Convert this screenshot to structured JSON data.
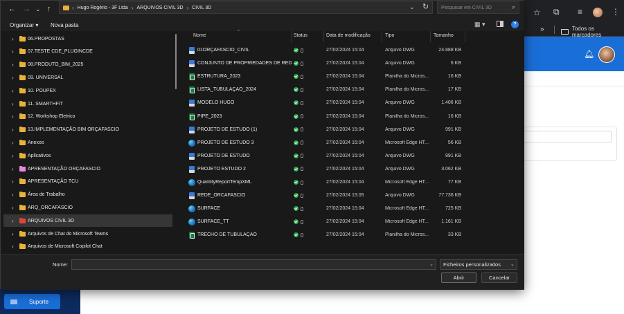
{
  "browser": {
    "bookmarks_folder_label": "Todos os marcadores",
    "overflow_chevron": "»",
    "support_button_label": "Suporte"
  },
  "dialog": {
    "nav_buttons": {
      "back": "←",
      "forward": "→",
      "recent": "⌄",
      "up": "↑"
    },
    "path_segments": [
      "Hugo Rogério - 3F Ltda",
      "ARQUIVOS CIVIL 3D",
      "CIVIL 3D"
    ],
    "search_placeholder": "Pesquisar em CIVIL 3D",
    "toolbar": {
      "organize_label": "Organizar ▾",
      "new_folder_label": "Nova pasta"
    },
    "nav_items": [
      {
        "label": "06.PROPOSTAS",
        "color": "#e8b33a"
      },
      {
        "label": "07.TESTE CDE_PLUGINCDE",
        "color": "#e8b33a"
      },
      {
        "label": "08.PRODUTO_BIM_2025",
        "color": "#e8b33a"
      },
      {
        "label": "09. UNIVERSAL",
        "color": "#e8b33a"
      },
      {
        "label": "10. POUPEX",
        "color": "#e8b33a"
      },
      {
        "label": "11. SMARTHFIT",
        "color": "#e8b33a"
      },
      {
        "label": "12. Workshop Eletrico",
        "color": "#e8b33a"
      },
      {
        "label": "13.IMPLEMENTAÇÃO BIM ORÇAFASCIO",
        "color": "#e8b33a"
      },
      {
        "label": "Anexos",
        "color": "#e8b33a"
      },
      {
        "label": "Aplicativos",
        "color": "#e8b33a"
      },
      {
        "label": "APRESENTAÇÃO ORÇAFASCIO",
        "color": "#e48ad8"
      },
      {
        "label": "APRESENTAÇÃO TCU",
        "color": "#e8b33a"
      },
      {
        "label": "Área de Trabalho",
        "color": "#e8b33a"
      },
      {
        "label": "ARQ_ORCAFASCIO",
        "color": "#e8b33a"
      },
      {
        "label": "ARQUIVOS CIVIL 3D",
        "color": "#e0443a"
      },
      {
        "label": "Arquivos de Chat do Microsoft Teams",
        "color": "#e8b33a"
      },
      {
        "label": "Arquivos de Microsoft Copilot Chat",
        "color": "#e8b33a"
      }
    ],
    "columns": {
      "name": "Nome",
      "status": "Status",
      "modified": "Data de modificação",
      "type": "Tipo",
      "size": "Tamanho"
    },
    "files": [
      {
        "name": "01ORÇAFASCIO_CIVIL",
        "icon": "dwg",
        "date": "27/02/2024 15:04",
        "type": "Arquivo DWG",
        "size": "24.888 KB"
      },
      {
        "name": "CONJUNTO DE PROPRIEDADES DE REDE",
        "icon": "dwg",
        "date": "27/02/2024 15:04",
        "type": "Arquivo DWG",
        "size": "6 KB"
      },
      {
        "name": "ESTRUTURA_2023",
        "icon": "xls",
        "date": "27/02/2024 15:04",
        "type": "Planilha do Micros...",
        "size": "16 KB"
      },
      {
        "name": "LISTA_TUBULAÇÃO_2024",
        "icon": "xls",
        "date": "27/02/2024 15:04",
        "type": "Planilha do Micros...",
        "size": "17 KB"
      },
      {
        "name": "MODELO HUGO",
        "icon": "dwg",
        "date": "27/02/2024 15:04",
        "type": "Arquivo DWG",
        "size": "1.406 KB"
      },
      {
        "name": "PIPE_2023",
        "icon": "xls",
        "date": "27/02/2024 15:04",
        "type": "Planilha do Micros...",
        "size": "16 KB"
      },
      {
        "name": "PROJETO DE ESTUDO (1)",
        "icon": "dwg",
        "date": "27/02/2024 15:04",
        "type": "Arquivo DWG",
        "size": "991 KB"
      },
      {
        "name": "PROJETO DE ESTUDO 3",
        "icon": "edge",
        "date": "27/02/2024 15:04",
        "type": "Microsoft Edge HT...",
        "size": "56 KB"
      },
      {
        "name": "PROJETO DE ESTUDO",
        "icon": "dwg",
        "date": "27/02/2024 15:04",
        "type": "Arquivo DWG",
        "size": "991 KB"
      },
      {
        "name": "PROJETO ESTUDO 2",
        "icon": "dwg",
        "date": "27/02/2024 15:04",
        "type": "Arquivo DWG",
        "size": "3.062 KB"
      },
      {
        "name": "QuantityReportTempXML",
        "icon": "edge",
        "date": "27/02/2024 15:04",
        "type": "Microsoft Edge HT...",
        "size": "77 KB"
      },
      {
        "name": "REDE_ORCAFASCIO",
        "icon": "dwg",
        "date": "27/02/2024 15:05",
        "type": "Arquivo DWG",
        "size": "77.736 KB"
      },
      {
        "name": "SURFACE",
        "icon": "edge",
        "date": "27/02/2024 15:04",
        "type": "Microsoft Edge HT...",
        "size": "725 KB"
      },
      {
        "name": "SURFACE_TT",
        "icon": "edge",
        "date": "27/02/2024 15:04",
        "type": "Microsoft Edge HT...",
        "size": "1.161 KB"
      },
      {
        "name": "TRECHO DE TUBULAÇÃO",
        "icon": "xls",
        "date": "27/02/2024 15:04",
        "type": "Planilha do Micros...",
        "size": "33 KB"
      }
    ],
    "bottom": {
      "name_label": "Nome:",
      "name_value": "",
      "filter_value": "Ficheiros personalizados",
      "open_label": "Abrir",
      "cancel_label": "Cancelar"
    }
  },
  "colors": {
    "dialog_bg": "#191919",
    "selected_row": "#363636",
    "status_synced": "#2fa84f",
    "site_header": "#1a6ed8",
    "site_sidebar": "#0d2b5e"
  }
}
